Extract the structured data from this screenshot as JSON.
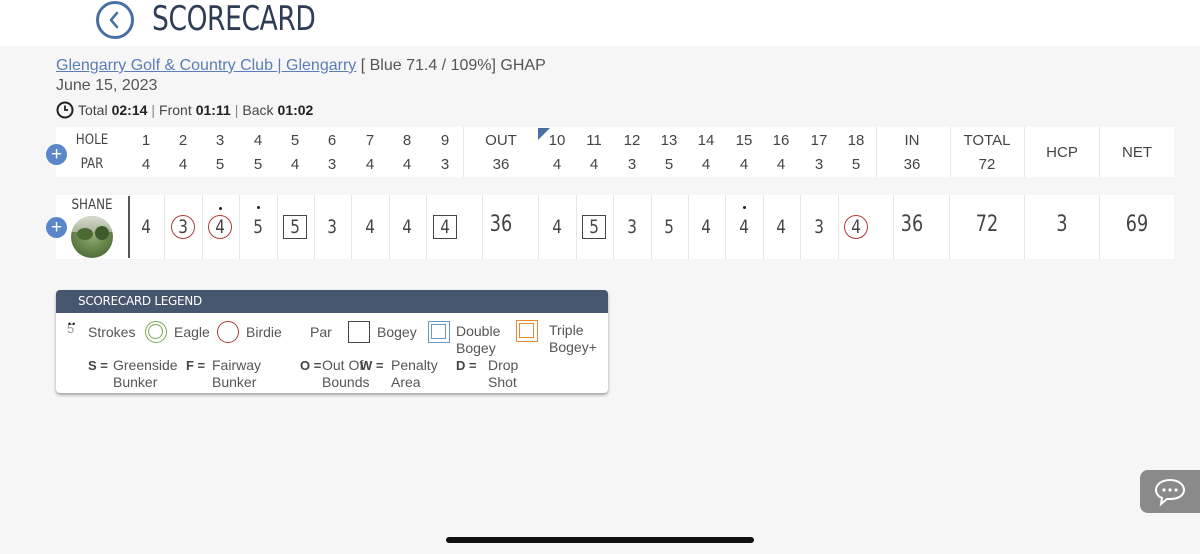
{
  "header": {
    "title": "SCORECARD",
    "back_icon": "chevron-left-icon"
  },
  "round": {
    "course_link": "Glengarry Golf & Country Club | Glengarry",
    "tee_info": "[ Blue 71.4 / 109%]",
    "format": "GHAP",
    "date": "June 15, 2023",
    "total_label": "Total",
    "total_time": "02:14",
    "front_label": "Front",
    "front_time": "01:11",
    "back_label": "Back",
    "back_time": "01:02"
  },
  "table": {
    "hole_label": "HOLE",
    "par_label": "PAR",
    "holes": [
      "1",
      "2",
      "3",
      "4",
      "5",
      "6",
      "7",
      "8",
      "9",
      "OUT",
      "10",
      "11",
      "12",
      "13",
      "14",
      "15",
      "16",
      "17",
      "18",
      "IN",
      "TOTAL",
      "HCP",
      "NET"
    ],
    "pars": [
      "4",
      "4",
      "5",
      "5",
      "4",
      "3",
      "4",
      "4",
      "3",
      "36",
      "4",
      "4",
      "3",
      "5",
      "4",
      "4",
      "4",
      "3",
      "5",
      "36",
      "72",
      "",
      ""
    ]
  },
  "player": {
    "name": "SHANE",
    "scores": [
      {
        "v": "4",
        "mark": "none",
        "dots": 0
      },
      {
        "v": "3",
        "mark": "circle",
        "dots": 0
      },
      {
        "v": "4",
        "mark": "circle",
        "dots": 1
      },
      {
        "v": "5",
        "mark": "none",
        "dots": 1
      },
      {
        "v": "5",
        "mark": "square",
        "dots": 0
      },
      {
        "v": "3",
        "mark": "none",
        "dots": 0
      },
      {
        "v": "4",
        "mark": "none",
        "dots": 0
      },
      {
        "v": "4",
        "mark": "none",
        "dots": 0
      },
      {
        "v": "4",
        "mark": "square",
        "dots": 0
      },
      {
        "v": "36",
        "mark": "total",
        "dots": 0
      },
      {
        "v": "4",
        "mark": "none",
        "dots": 0
      },
      {
        "v": "5",
        "mark": "square",
        "dots": 0
      },
      {
        "v": "3",
        "mark": "none",
        "dots": 0
      },
      {
        "v": "5",
        "mark": "none",
        "dots": 0
      },
      {
        "v": "4",
        "mark": "none",
        "dots": 0
      },
      {
        "v": "4",
        "mark": "none",
        "dots": 1
      },
      {
        "v": "4",
        "mark": "none",
        "dots": 0
      },
      {
        "v": "3",
        "mark": "none",
        "dots": 0
      },
      {
        "v": "4",
        "mark": "circle",
        "dots": 0
      },
      {
        "v": "36",
        "mark": "total",
        "dots": 0
      },
      {
        "v": "72",
        "mark": "total",
        "dots": 0
      },
      {
        "v": "3",
        "mark": "total",
        "dots": 0
      },
      {
        "v": "69",
        "mark": "total",
        "dots": 0
      }
    ]
  },
  "legend": {
    "title": "SCORECARD LEGEND",
    "strokes_sample": "5",
    "strokes": "Strokes",
    "eagle": "Eagle",
    "birdie": "Birdie",
    "par": "Par",
    "bogey": "Bogey",
    "double_bogey_1": "Double",
    "double_bogey_2": "Bogey",
    "triple_bogey_1": "Triple",
    "triple_bogey_2": "Bogey+",
    "codes": [
      {
        "key": "S =",
        "l1": "Greenside",
        "l2": "Bunker"
      },
      {
        "key": "F =",
        "l1": "Fairway",
        "l2": "Bunker"
      },
      {
        "key": "O =",
        "l1": "Out Of",
        "l2": "Bounds"
      },
      {
        "key": "W =",
        "l1": "Penalty",
        "l2": "Area"
      },
      {
        "key": "D =",
        "l1": "Drop",
        "l2": "Shot"
      }
    ]
  },
  "colors": {
    "accent": "#4a6fa5",
    "birdie": "#b03a3a",
    "eagle": "#7aa84f",
    "double": "#6b9ac4",
    "triple": "#e08a3c",
    "legend_header": "#46566f"
  }
}
